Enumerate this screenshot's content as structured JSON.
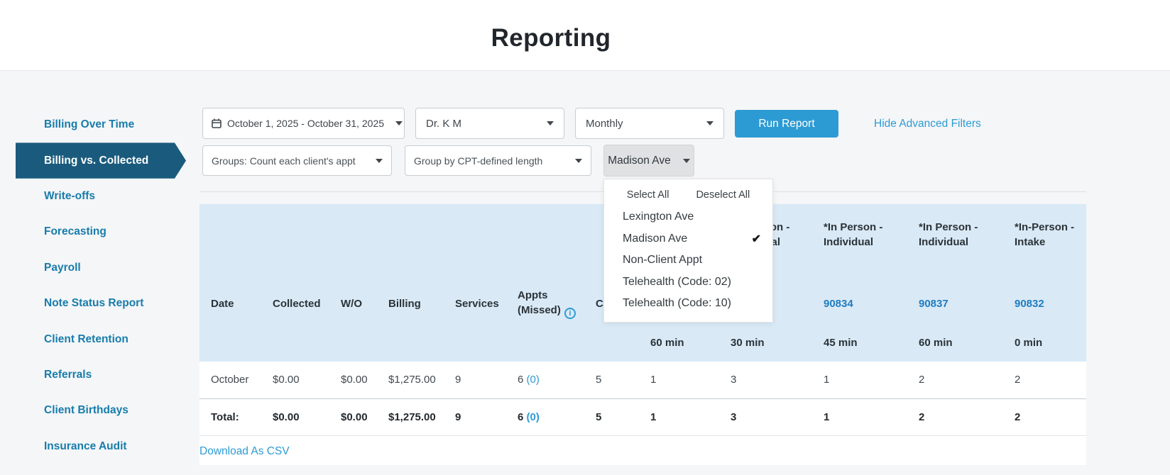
{
  "page": {
    "title": "Reporting"
  },
  "sidebar": {
    "items": [
      {
        "label": "Billing Over Time",
        "active": false
      },
      {
        "label": "Billing vs. Collected",
        "active": true
      },
      {
        "label": "Write-offs",
        "active": false
      },
      {
        "label": "Forecasting",
        "active": false
      },
      {
        "label": "Payroll",
        "active": false
      },
      {
        "label": "Note Status Report",
        "active": false
      },
      {
        "label": "Client Retention",
        "active": false
      },
      {
        "label": "Referrals",
        "active": false
      },
      {
        "label": "Client Birthdays",
        "active": false
      },
      {
        "label": "Insurance Audit",
        "active": false
      }
    ]
  },
  "filters": {
    "date_range": "October 1, 2025 - October 31, 2025",
    "clinician": "Dr. K M",
    "period": "Monthly",
    "run_report_label": "Run Report",
    "hide_advanced_label": "Hide Advanced Filters",
    "groups_select": "Groups: Count each client's appt",
    "group_by_select": "Group by CPT-defined length",
    "location_button": "Madison Ave"
  },
  "location_dropdown": {
    "select_all": "Select All",
    "deselect_all": "Deselect All",
    "options": [
      {
        "label": "Lexington Ave",
        "checked": false
      },
      {
        "label": "Madison Ave",
        "checked": true
      },
      {
        "label": "Non-Client Appt",
        "checked": false
      },
      {
        "label": "Telehealth (Code: 02)",
        "checked": false
      },
      {
        "label": "Telehealth (Code: 10)",
        "checked": false
      }
    ],
    "check_glyph": "✔"
  },
  "table": {
    "header": {
      "labels": [
        "Date",
        "Collected",
        "W/O",
        "Billing",
        "Services",
        "Appts (Missed)",
        "Clients"
      ],
      "cpt_columns": [
        {
          "title": "",
          "code": "",
          "duration": "60 min"
        },
        {
          "title": "*In Person - Individual",
          "code": "",
          "duration": "30 min"
        },
        {
          "title": "*In Person - Individual",
          "code": "90834",
          "duration": "45 min"
        },
        {
          "title": "*In Person - Individual",
          "code": "90837",
          "duration": "60 min"
        },
        {
          "title": "*In-Person - Intake",
          "code": "90832",
          "duration": "0 min"
        }
      ]
    },
    "rows": [
      {
        "date": "October",
        "collected": "$0.00",
        "wo": "$0.00",
        "billing": "$1,275.00",
        "services": "9",
        "appts": "6",
        "appts_missed": "(0)",
        "clients": "5",
        "c8": "1",
        "c9": "3",
        "c10": "1",
        "c11": "2",
        "c12": "2"
      }
    ],
    "total": {
      "label": "Total:",
      "collected": "$0.00",
      "wo": "$0.00",
      "billing": "$1,275.00",
      "services": "9",
      "appts": "6",
      "appts_missed": "(0)",
      "clients": "5",
      "c8": "1",
      "c9": "3",
      "c10": "1",
      "c11": "2",
      "c12": "2"
    }
  },
  "footer": {
    "download_csv": "Download As CSV"
  }
}
